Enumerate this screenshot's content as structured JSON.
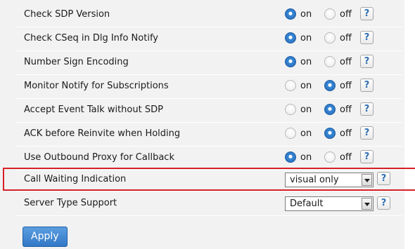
{
  "settings": [
    {
      "label": "Check SDP Version",
      "on_label": "on",
      "off_label": "off",
      "selected": "on",
      "help": "?"
    },
    {
      "label": "Check CSeq in Dlg Info Notify",
      "on_label": "on",
      "off_label": "off",
      "selected": "on",
      "help": "?"
    },
    {
      "label": "Number Sign Encoding",
      "on_label": "on",
      "off_label": "off",
      "selected": "on",
      "help": "?"
    },
    {
      "label": "Monitor Notify for Subscriptions",
      "on_label": "on",
      "off_label": "off",
      "selected": "off",
      "help": "?"
    },
    {
      "label": "Accept Event Talk without SDP",
      "on_label": "on",
      "off_label": "off",
      "selected": "off",
      "help": "?"
    },
    {
      "label": "ACK before Reinvite when Holding",
      "on_label": "on",
      "off_label": "off",
      "selected": "off",
      "help": "?"
    },
    {
      "label": "Use Outbound Proxy for Callback",
      "on_label": "on",
      "off_label": "off",
      "selected": "on",
      "help": "?"
    }
  ],
  "call_waiting": {
    "label": "Call Waiting Indication",
    "value": "visual only",
    "help": "?",
    "highlight_color": "#d6202a"
  },
  "server_type": {
    "label": "Server Type Support",
    "value": "Default",
    "help": "?"
  },
  "apply_label": "Apply",
  "accent_color": "#2f6fb4"
}
